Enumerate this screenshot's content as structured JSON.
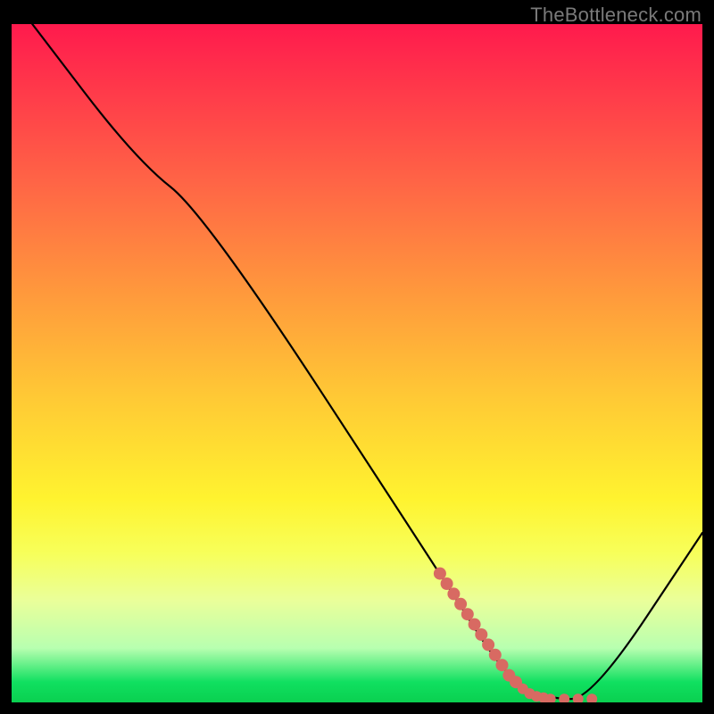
{
  "watermark": "TheBottleneck.com",
  "colors": {
    "line": "#000000",
    "marker": "#d86a62",
    "marker_stroke": "#d86a62"
  },
  "chart_data": {
    "type": "line",
    "title": "",
    "xlabel": "",
    "ylabel": "",
    "xlim": [
      0,
      100
    ],
    "ylim": [
      0,
      100
    ],
    "series": [
      {
        "name": "curve",
        "x": [
          3,
          18,
          28,
          62,
          72,
          78,
          84,
          100
        ],
        "y": [
          100,
          80,
          72,
          19,
          3,
          0.5,
          0.5,
          25
        ]
      }
    ],
    "markers": {
      "name": "highlight",
      "x": [
        62,
        63,
        64,
        65,
        66,
        67,
        68,
        69,
        70,
        71,
        72,
        73,
        74,
        75,
        76,
        77,
        78,
        80,
        82,
        84
      ],
      "y": [
        19,
        17.5,
        16,
        14.5,
        13,
        11.5,
        10,
        8.5,
        7,
        5.5,
        4,
        3,
        2,
        1.3,
        0.9,
        0.7,
        0.5,
        0.5,
        0.5,
        0.5
      ]
    }
  }
}
